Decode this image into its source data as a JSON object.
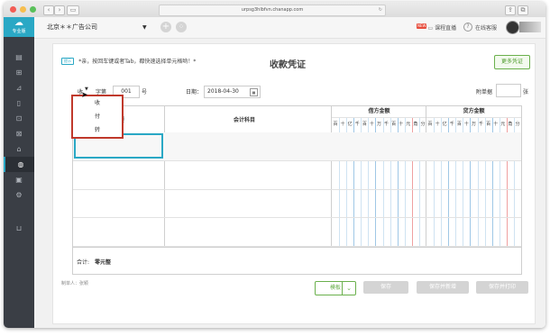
{
  "browser": {
    "url": "urpsg3hlbfvn.chanapp.com",
    "back_icon": "chevron-left-icon",
    "forward_icon": "chevron-right-icon"
  },
  "sidebar": {
    "logo_label": "专业版",
    "items": [
      {
        "icon": "document-icon"
      },
      {
        "icon": "import-icon"
      },
      {
        "icon": "chart-icon"
      },
      {
        "icon": "receipt-icon"
      },
      {
        "icon": "invoice-icon"
      },
      {
        "icon": "ledger-icon"
      },
      {
        "icon": "bank-icon"
      },
      {
        "icon": "people-icon"
      },
      {
        "icon": "image-icon"
      },
      {
        "icon": "gear-icon"
      },
      {
        "icon": "basket-icon"
      }
    ],
    "active_index": 7
  },
  "topbar": {
    "company": "北京＊＊广告公司",
    "course_badge": "NEW",
    "course_label": "课程直播",
    "help_label": "在线客服"
  },
  "voucher": {
    "hint_tag": "提示",
    "hint_text": "*亲，按回车键或者Tab，都快速选择单元格哟！*",
    "title": "收款凭证",
    "more_button": "更多凭证",
    "type_label": "收",
    "zi_label": "字第",
    "number": "001",
    "hao_label": "号",
    "date_label": "日期：",
    "date_value": "2018-04-30",
    "attach_label": "附单据",
    "attach_value": "",
    "attach_unit": "张",
    "dropdown_options": [
      "收",
      "付",
      "转"
    ],
    "col_summary": "摘要",
    "col_account": "会计科目",
    "col_debit": "借方金额",
    "col_credit": "贷方金额",
    "digit_units": [
      "百",
      "十",
      "亿",
      "千",
      "百",
      "十",
      "万",
      "千",
      "百",
      "十",
      "元",
      "角",
      "分"
    ],
    "total_label": "合计:",
    "total_value": "零元整",
    "maker_label": "制单人：张颖",
    "template_button": "模板",
    "save_button": "保存",
    "save_new_button": "保存并新增",
    "save_print_button": "保存并打印"
  },
  "colors": {
    "accent": "#2aa8c5",
    "green": "#6ab04c",
    "red_frame": "#c0392b"
  }
}
